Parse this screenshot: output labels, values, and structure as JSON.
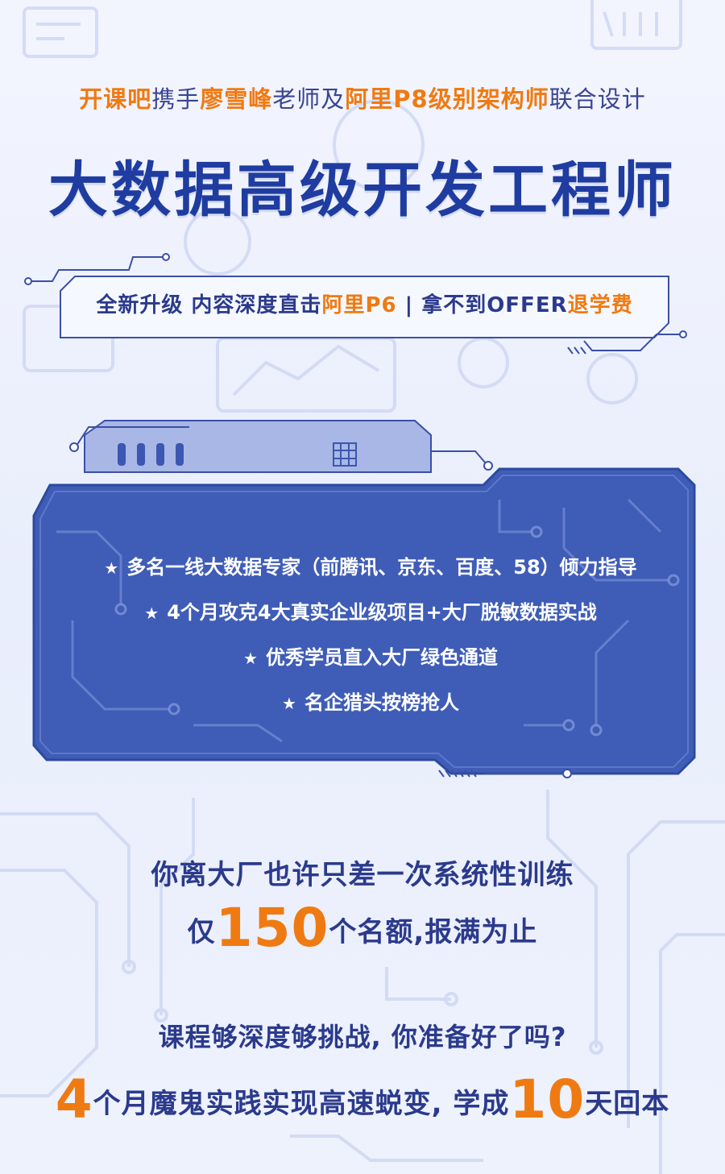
{
  "header": {
    "subtitle_parts": [
      {
        "text": "开课吧",
        "style": "hl"
      },
      {
        "text": "携手",
        "style": "plain"
      },
      {
        "text": "廖雪峰",
        "style": "hl"
      },
      {
        "text": "老师及",
        "style": "plain"
      },
      {
        "text": "阿里P8级别架构师",
        "style": "hl"
      },
      {
        "text": "联合设计",
        "style": "plain"
      }
    ],
    "title": "大数据高级开发工程师"
  },
  "tagline": {
    "part1": "全新升级  内容深度直击",
    "part2": "阿里P6",
    "part3": "  |  拿不到OFFER",
    "part4": "退学费"
  },
  "features": [
    "多名一线大数据专家（前腾讯、京东、百度、58）倾力指导",
    "4个月攻克4大真实企业级项目+大厂脱敏数据实战",
    "优秀学员直入大厂绿色通道",
    "名企猎头按榜抢人"
  ],
  "promo": {
    "line1": "你离大厂也许只差一次系统性训练",
    "line2_pre": "仅",
    "line2_num": "150",
    "line2_post": "个名额,报满为止",
    "line3": "课程够深度够挑战, 你准备好了吗?",
    "line4_num1": "4",
    "line4_mid": "个月魔鬼实践实现高速蜕变, 学成",
    "line4_num2": "10",
    "line4_post": "天回本"
  },
  "colors": {
    "accent": "#f07a12",
    "primary": "#1f3ca0",
    "text": "#2b3a8c",
    "panel": "#3e5cb5",
    "background": "#eef2fd"
  }
}
